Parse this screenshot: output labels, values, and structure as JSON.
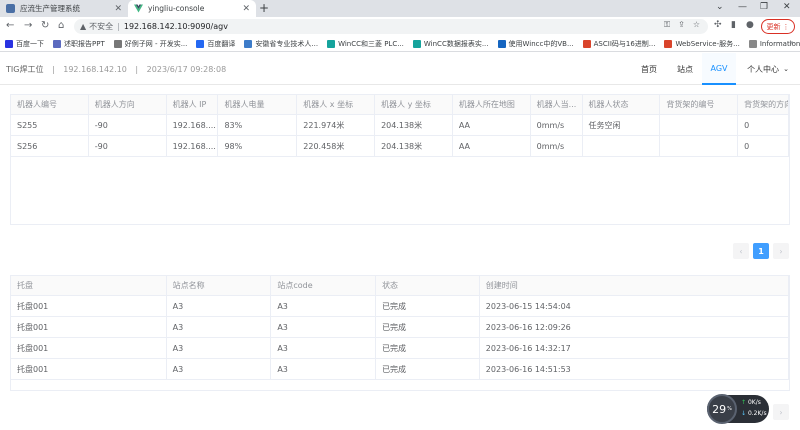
{
  "browser": {
    "tabs": [
      {
        "title": "应流生产管理系统",
        "active": false
      },
      {
        "title": "yingliu-console",
        "active": true
      }
    ],
    "address": {
      "security_label": "不安全",
      "url": "192.168.142.10:9090/agv"
    },
    "update_label": "更新",
    "bookmarks": [
      {
        "label": "百度一下",
        "color": "#2932e1"
      },
      {
        "label": "述职报告PPT",
        "color": "#5b6abf"
      },
      {
        "label": "好例子网 - 开发实...",
        "color": "#777777"
      },
      {
        "label": "百度翻译",
        "color": "#2468f2"
      },
      {
        "label": "安徽省专业技术人...",
        "color": "#3d7cc9"
      },
      {
        "label": "WinCC和三菱 PLC...",
        "color": "#15a39c"
      },
      {
        "label": "WinCC数据报表实...",
        "color": "#15a39c"
      },
      {
        "label": "使用Wincc中的VB...",
        "color": "#1565c0"
      },
      {
        "label": "ASCII码与16进制...",
        "color": "#d9442b"
      },
      {
        "label": "WebService-服务...",
        "color": "#d9442b"
      },
      {
        "label": "Information Serve...",
        "color": "#888888"
      }
    ]
  },
  "app": {
    "station_name": "TIG焊工位",
    "separator": "|",
    "ip": "192.168.142.10",
    "datetime": "2023/6/17 09:28:08",
    "menu": [
      {
        "label": "首页",
        "active": false
      },
      {
        "label": "站点",
        "active": false
      },
      {
        "label": "AGV",
        "active": true
      },
      {
        "label": "个人中心",
        "active": false
      }
    ]
  },
  "robots_table": {
    "columns": [
      "机器人编号",
      "机器人方向",
      "机器人 IP",
      "机器人电量",
      "机器人 x 坐标",
      "机器人 y 坐标",
      "机器人所在地图",
      "机器人当...",
      "机器人状态",
      "背货架的编号",
      "背货架的方向"
    ],
    "rows": [
      [
        "S255",
        "-90",
        "192.168....",
        "83%",
        "221.974米",
        "204.138米",
        "AA",
        "0mm/s",
        "任务空闲",
        "",
        "0"
      ],
      [
        "S256",
        "-90",
        "192.168....",
        "98%",
        "220.458米",
        "204.138米",
        "AA",
        "0mm/s",
        "",
        "",
        "0"
      ]
    ]
  },
  "pagination1": {
    "prev": "‹",
    "current": "1",
    "next": "›"
  },
  "trays_table": {
    "columns": [
      "托盘",
      "站点名称",
      "站点code",
      "状态",
      "创建时间"
    ],
    "rows": [
      [
        "托盘001",
        "A3",
        "A3",
        "已完成",
        "2023-06-15 14:54:04"
      ],
      [
        "托盘001",
        "A3",
        "A3",
        "已完成",
        "2023-06-16 12:09:26"
      ],
      [
        "托盘001",
        "A3",
        "A3",
        "已完成",
        "2023-06-16 14:32:17"
      ],
      [
        "托盘001",
        "A3",
        "A3",
        "已完成",
        "2023-06-16 14:51:53"
      ]
    ]
  },
  "pagination2": {
    "next": "›"
  },
  "net_widget": {
    "percent": "29",
    "percent_unit": "%",
    "up": "0K/s",
    "down": "0.2K/s"
  }
}
